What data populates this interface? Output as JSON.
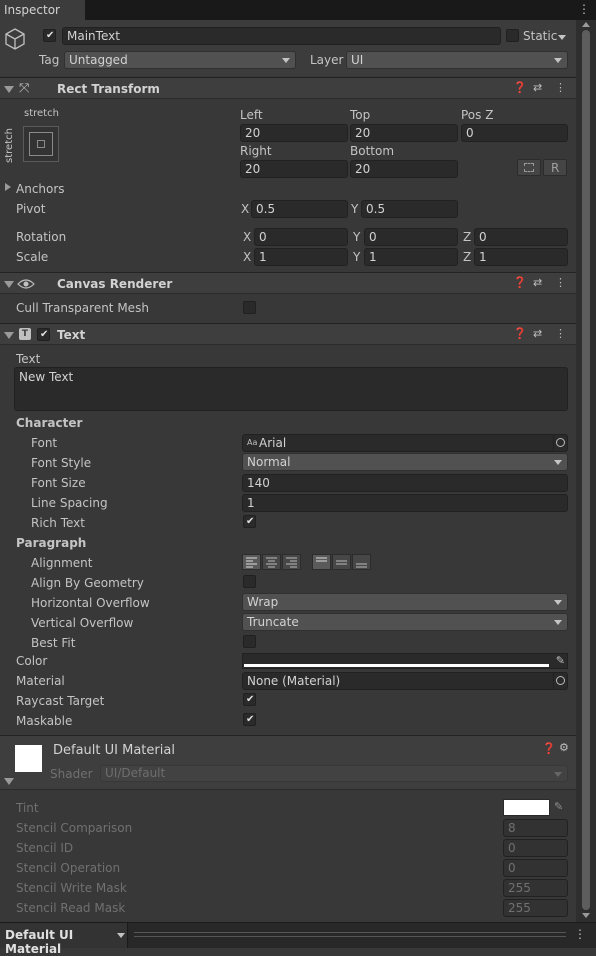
{
  "tab": {
    "title": "Inspector"
  },
  "object": {
    "name": "MainText",
    "static_label": "Static",
    "tag_label": "Tag",
    "tag_value": "Untagged",
    "layer_label": "Layer",
    "layer_value": "UI"
  },
  "rect_transform": {
    "title": "Rect Transform",
    "anchor_preset_top": "stretch",
    "anchor_preset_side": "stretch",
    "left_label": "Left",
    "left_value": "20",
    "top_label": "Top",
    "top_value": "20",
    "posz_label": "Pos Z",
    "posz_value": "0",
    "right_label": "Right",
    "right_value": "20",
    "bottom_label": "Bottom",
    "bottom_value": "20",
    "r_button": "R",
    "anchors_label": "Anchors",
    "pivot_label": "Pivot",
    "pivot_x": "0.5",
    "pivot_y": "0.5",
    "rotation_label": "Rotation",
    "rot_x": "0",
    "rot_y": "0",
    "rot_z": "0",
    "scale_label": "Scale",
    "scale_x": "1",
    "scale_y": "1",
    "scale_z": "1",
    "x": "X",
    "y": "Y",
    "z": "Z"
  },
  "canvas_renderer": {
    "title": "Canvas Renderer",
    "cull_label": "Cull Transparent Mesh"
  },
  "text": {
    "title": "Text",
    "text_label": "Text",
    "text_value": "New Text",
    "character_label": "Character",
    "font_label": "Font",
    "font_value": "Arial",
    "font_prefix": "Aa",
    "font_style_label": "Font Style",
    "font_style_value": "Normal",
    "font_size_label": "Font Size",
    "font_size_value": "140",
    "line_spacing_label": "Line Spacing",
    "line_spacing_value": "1",
    "rich_text_label": "Rich Text",
    "paragraph_label": "Paragraph",
    "alignment_label": "Alignment",
    "align_geometry_label": "Align By Geometry",
    "h_overflow_label": "Horizontal Overflow",
    "h_overflow_value": "Wrap",
    "v_overflow_label": "Vertical Overflow",
    "v_overflow_value": "Truncate",
    "best_fit_label": "Best Fit",
    "color_label": "Color",
    "color_value": "#ffffff",
    "material_label": "Material",
    "material_value": "None (Material)",
    "raycast_label": "Raycast Target",
    "maskable_label": "Maskable"
  },
  "material": {
    "name": "Default UI Material",
    "shader_label": "Shader",
    "shader_value": "UI/Default",
    "tint_label": "Tint",
    "stencil_comparison_label": "Stencil Comparison",
    "stencil_comparison_value": "8",
    "stencil_id_label": "Stencil ID",
    "stencil_id_value": "0",
    "stencil_operation_label": "Stencil Operation",
    "stencil_operation_value": "0",
    "stencil_write_label": "Stencil Write Mask",
    "stencil_write_value": "255",
    "stencil_read_label": "Stencil Read Mask",
    "stencil_read_value": "255"
  },
  "footer": {
    "label": "Default UI Material"
  },
  "colors": {
    "background": "#383838",
    "header": "#3e3e3e",
    "field": "#2a2a2a",
    "text": "#c4c4c4"
  }
}
